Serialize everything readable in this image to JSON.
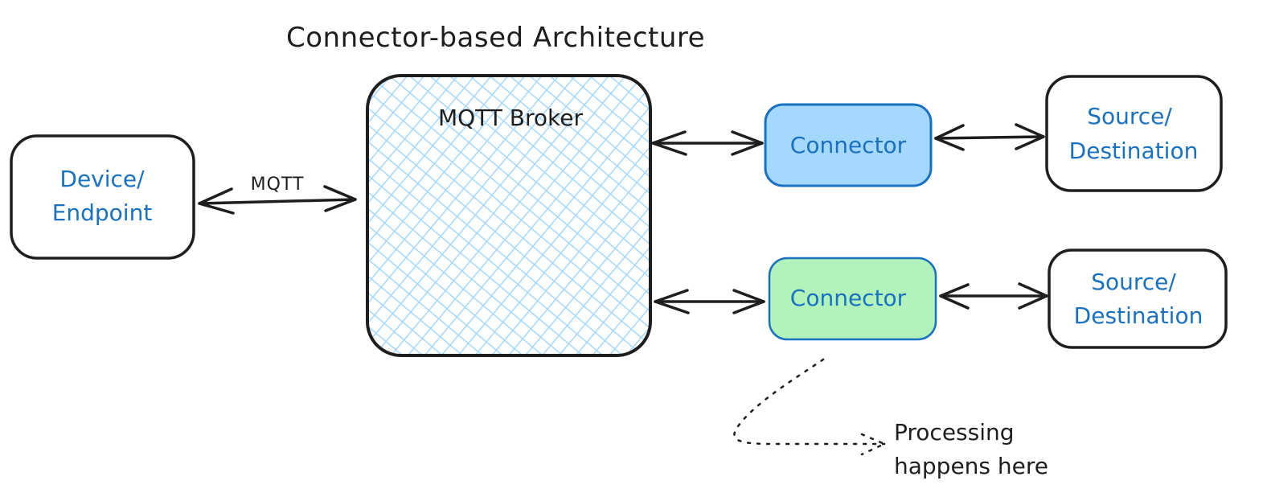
{
  "title": "Connector-based Architecture",
  "colors": {
    "stroke": "#1e1e1e",
    "label_blue": "#1971c2",
    "broker_hatch": "#a5d8ff",
    "connector_top_fill": "#a5d8ff",
    "connector_top_stroke": "#1971c2",
    "connector_bottom_fill": "#b2f2bb",
    "connector_bottom_stroke": "#1971c2"
  },
  "nodes": {
    "device": {
      "line1": "Device/",
      "line2": "Endpoint"
    },
    "broker": {
      "label": "MQTT Broker"
    },
    "connector_top": {
      "label": "Connector"
    },
    "connector_bottom": {
      "label": "Connector"
    },
    "source_top": {
      "line1": "Source/",
      "line2": "Destination"
    },
    "source_bottom": {
      "line1": "Source/",
      "line2": "Destination"
    }
  },
  "edges": {
    "device_broker": {
      "label": "MQTT",
      "direction": "bidirectional"
    },
    "broker_connector_top": {
      "label": "",
      "direction": "bidirectional"
    },
    "broker_connector_bottom": {
      "label": "",
      "direction": "bidirectional"
    },
    "connector_top_source_top": {
      "label": "",
      "direction": "bidirectional"
    },
    "connector_bottom_source_bottom": {
      "label": "",
      "direction": "bidirectional"
    }
  },
  "annotation": {
    "line1": "Processing",
    "line2": "happens here",
    "points_to": "connector_bottom",
    "style": "dotted"
  }
}
